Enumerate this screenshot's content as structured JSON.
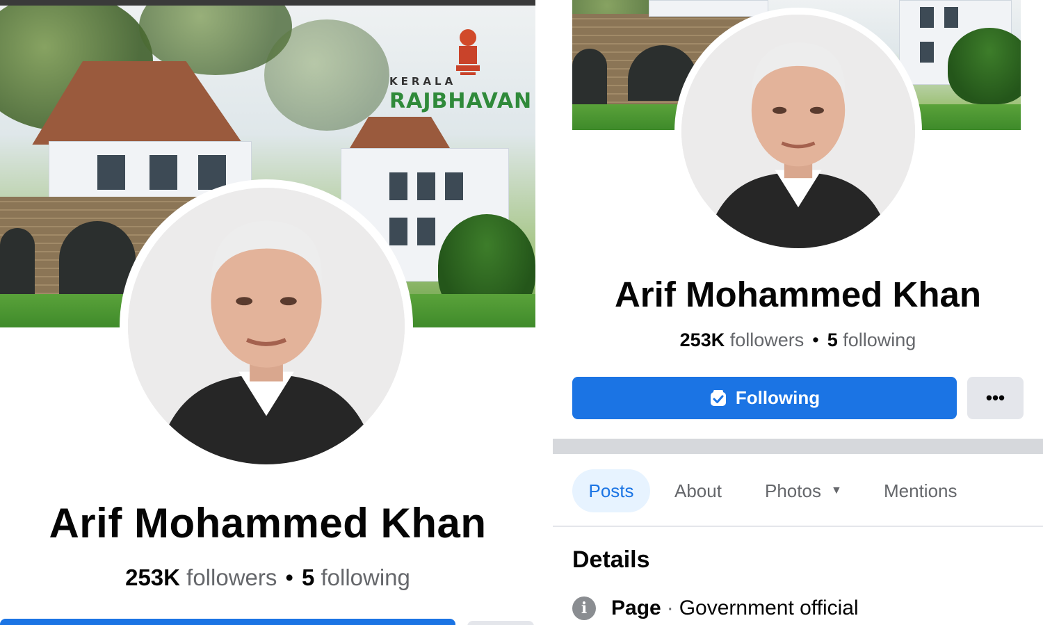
{
  "left": {
    "cover": {
      "brand_line1": "KERALA",
      "brand_line2": "RAJBHAVAN"
    },
    "profile": {
      "name": "Arif Mohammed Khan",
      "followers_count": "253K",
      "followers_label": "followers",
      "following_count": "5",
      "following_label": "following"
    }
  },
  "right": {
    "profile": {
      "name": "Arif Mohammed Khan",
      "followers_count": "253K",
      "followers_label": "followers",
      "following_count": "5",
      "following_label": "following"
    },
    "actions": {
      "following_label": "Following",
      "more_label": "•••"
    },
    "tabs": [
      {
        "label": "Posts",
        "active": true
      },
      {
        "label": "About",
        "active": false
      },
      {
        "label": "Photos",
        "active": false,
        "has_dropdown": true
      },
      {
        "label": "Mentions",
        "active": false
      }
    ],
    "details": {
      "heading": "Details",
      "items": [
        {
          "icon": "info-icon",
          "label": "Page",
          "value": "Government official"
        }
      ]
    }
  },
  "colors": {
    "primary": "#1b74e4",
    "secondary_text": "#65676b",
    "button_gray": "#e4e6eb",
    "active_tab_bg": "#e7f3ff"
  }
}
